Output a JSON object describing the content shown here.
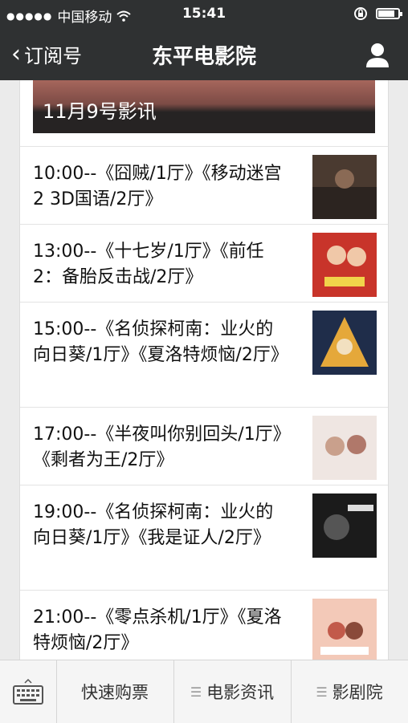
{
  "status_bar": {
    "carrier": "中国移动",
    "time": "15:41",
    "battery_level": 0.85
  },
  "nav": {
    "back_label": "订阅号",
    "title": "东平电影院"
  },
  "banner": {
    "label": "11月9号影讯"
  },
  "schedule": [
    {
      "text": "10:00--《囧贼/1厅》《移动迷宫2  3D国语/2厅》"
    },
    {
      "text": "13:00--《十七岁/1厅》《前任2：备胎反击战/2厅》"
    },
    {
      "text": "15:00--《名侦探柯南：业火的向日葵/1厅》《夏洛特烦恼/2厅》"
    },
    {
      "text": "17:00--《半夜叫你别回头/1厅》《剩者为王/2厅》"
    },
    {
      "text": "19:00--《名侦探柯南：业火的向日葵/1厅》《我是证人/2厅》"
    },
    {
      "text": "21:00--《零点杀机/1厅》《夏洛特烦恼/2厅》"
    }
  ],
  "tabbar": {
    "tab1": "快速购票",
    "tab2": "电影资讯",
    "tab3": "影剧院"
  }
}
